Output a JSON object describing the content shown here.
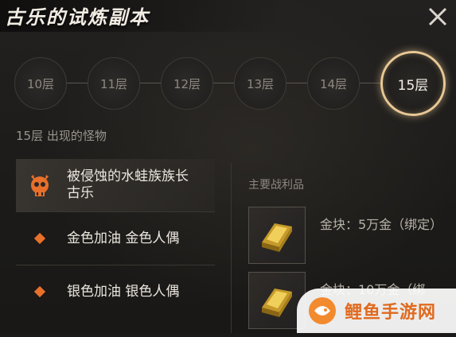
{
  "title": "古乐的试炼副本",
  "floors": [
    "10层",
    "11层",
    "12层",
    "13层",
    "14层",
    "15层"
  ],
  "active_floor": "15层",
  "monsters_heading": "15层 出现的怪物",
  "monsters": [
    {
      "label": "被侵蚀的水蛙族族长 古乐",
      "icon": "boss-skull-icon"
    },
    {
      "label": "金色加油 金色人偶",
      "icon": "diamond-icon"
    },
    {
      "label": "银色加油 银色人偶",
      "icon": "diamond-icon"
    }
  ],
  "loot_heading": "主要战利品",
  "loot": [
    {
      "label": "金块：5万金（绑定）",
      "icon": "gold-bar-icon"
    },
    {
      "label": "金块：10万金（绑",
      "icon": "gold-bar-icon"
    }
  ],
  "watermark": "鲤鱼手游网",
  "colors": {
    "accent": "#e8c894",
    "boss_icon": "#e8702a",
    "watermark": "#e06a1e"
  }
}
